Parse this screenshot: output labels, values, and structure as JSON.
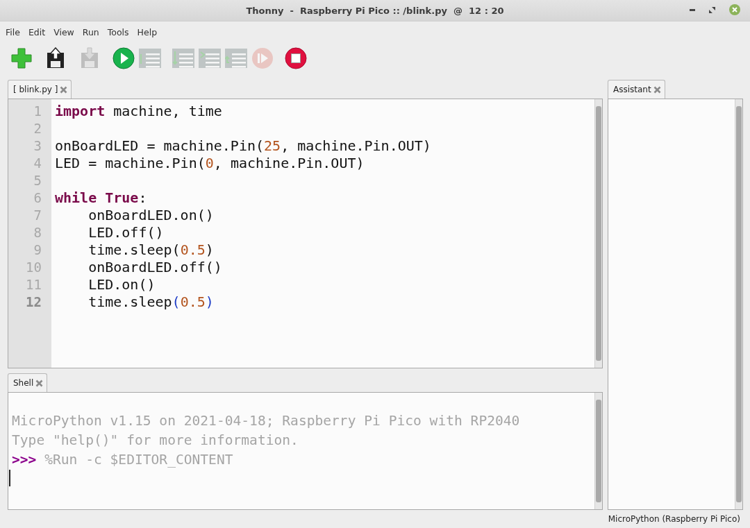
{
  "window": {
    "title": "Thonny  -  Raspberry Pi Pico :: /blink.py  @  12 : 20"
  },
  "menu": [
    "File",
    "Edit",
    "View",
    "Run",
    "Tools",
    "Help"
  ],
  "toolbar": [
    {
      "kind": "new",
      "disabled": false
    },
    {
      "kind": "load",
      "disabled": false
    },
    {
      "kind": "save",
      "disabled": true
    },
    {
      "kind": "run",
      "disabled": false
    },
    {
      "kind": "debug",
      "disabled": true
    },
    {
      "kind": "step-over",
      "disabled": true
    },
    {
      "kind": "step-into",
      "disabled": true
    },
    {
      "kind": "step-out",
      "disabled": true
    },
    {
      "kind": "resume",
      "disabled": true
    },
    {
      "kind": "stop",
      "disabled": false
    }
  ],
  "editor": {
    "tabs": [
      {
        "label": "[ blink.py ]",
        "selected": true
      }
    ],
    "lines": [
      {
        "number": "1",
        "current": false,
        "tokens": [
          {
            "text": "import",
            "kind": "keyword"
          },
          {
            "text": " machine, time",
            "kind": "plain"
          }
        ]
      },
      {
        "number": "2",
        "current": false
      },
      {
        "number": "3",
        "current": false,
        "tokens": [
          {
            "text": "onBoardLED = machine.Pin(",
            "kind": "plain"
          },
          {
            "text": "25",
            "kind": "number"
          },
          {
            "text": ", machine.Pin.OUT)",
            "kind": "plain"
          }
        ]
      },
      {
        "number": "4",
        "current": false,
        "tokens": [
          {
            "text": "LED = machine.Pin(",
            "kind": "plain"
          },
          {
            "text": "0",
            "kind": "number"
          },
          {
            "text": ", machine.Pin.OUT)",
            "kind": "plain"
          }
        ]
      },
      {
        "number": "5",
        "current": false
      },
      {
        "number": "6",
        "current": false,
        "tokens": [
          {
            "text": "while True",
            "kind": "keyword"
          },
          {
            "text": ":",
            "kind": "plain"
          }
        ]
      },
      {
        "number": "7",
        "current": false,
        "tokens": [
          {
            "text": "    onBoardLED.on()",
            "kind": "plain"
          }
        ]
      },
      {
        "number": "8",
        "current": false,
        "tokens": [
          {
            "text": "    LED.off()",
            "kind": "plain"
          }
        ]
      },
      {
        "number": "9",
        "current": false,
        "tokens": [
          {
            "text": "    time.sleep(",
            "kind": "plain"
          },
          {
            "text": "0.5",
            "kind": "number"
          },
          {
            "text": ")",
            "kind": "plain"
          }
        ]
      },
      {
        "number": "10",
        "current": false,
        "tokens": [
          {
            "text": "    onBoardLED.off()",
            "kind": "plain"
          }
        ]
      },
      {
        "number": "11",
        "current": false,
        "tokens": [
          {
            "text": "    LED.on()",
            "kind": "plain"
          }
        ]
      },
      {
        "number": "12",
        "current": true,
        "tokens": [
          {
            "text": "    time.sleep",
            "kind": "plain"
          },
          {
            "text": "(",
            "kind": "bracket"
          },
          {
            "text": "0.5",
            "kind": "number"
          },
          {
            "text": ")",
            "kind": "bracket"
          }
        ]
      }
    ]
  },
  "shell": {
    "tabs": [
      {
        "label": "Shell",
        "selected": true
      }
    ],
    "lines": [
      {
        "tokens": [
          {
            "text": "MicroPython v1.15 on 2021-04-18; Raspberry Pi Pico with RP2040",
            "kind": "output"
          }
        ]
      },
      {
        "tokens": [
          {
            "text": "Type \"help()\" for more information.",
            "kind": "output"
          }
        ]
      },
      {
        "tokens": [
          {
            "text": ">>>",
            "kind": "prompt"
          },
          {
            "text": " %Run -c $EDITOR_CONTENT",
            "kind": "output"
          }
        ]
      }
    ]
  },
  "assistant": {
    "tabs": [
      {
        "label": "Assistant",
        "selected": true
      }
    ]
  },
  "status_bar": "MicroPython (Raspberry Pi Pico)"
}
